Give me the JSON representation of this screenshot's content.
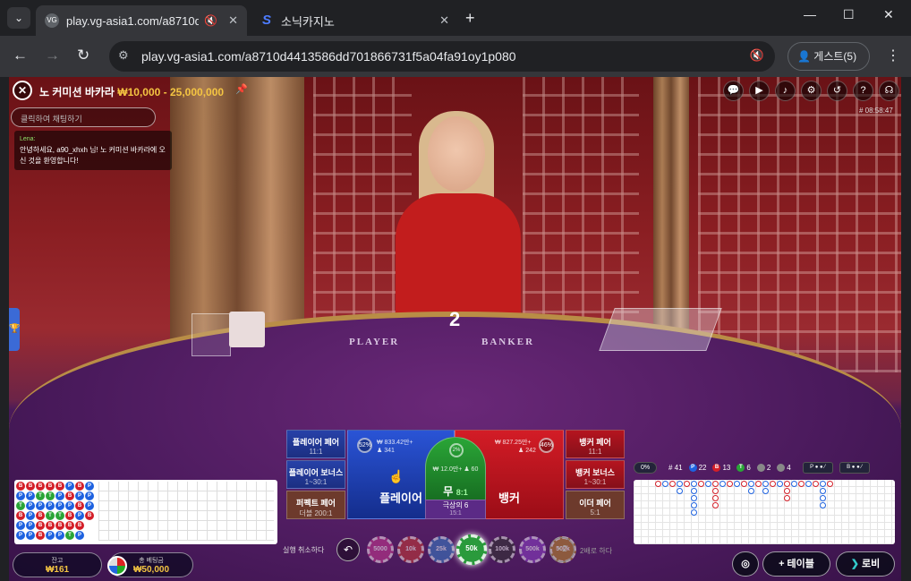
{
  "browser": {
    "tabs": [
      {
        "favicon": "VG",
        "title": "play.vg-asia1.com/a8710d4",
        "active": true
      },
      {
        "favicon": "S",
        "title": "소닉카지노",
        "active": false
      }
    ],
    "url": "play.vg-asia1.com/a8710d4413586dd701866731f5a04fa91oy1p080",
    "profile_label": "게스트(5)"
  },
  "game": {
    "table_name": "노 커미션 바카라",
    "limits": "₩10,000 - 25,000,000",
    "chat_placeholder": "클릭하여 채팅하기",
    "chat": {
      "user": "Lena:",
      "message": "안녕하세요, a90_xhxh 님! 노 커미션 바카라에 오신 것을 환영합니다!"
    },
    "game_id": "# 08:58:47",
    "round_number": "2",
    "felt_player": "PLAYER",
    "felt_banker": "BANKER",
    "hud_icons": [
      "chat-icon",
      "video-icon",
      "volume-icon",
      "settings-icon",
      "history-icon",
      "help-icon",
      "headset-icon"
    ]
  },
  "bets": {
    "player_pair": {
      "name": "플레이어 페어",
      "odds": "11:1"
    },
    "player_bonus": {
      "name": "플레이어 보너스",
      "odds": "1~30:1"
    },
    "perfect_pair": {
      "name": "퍼펙트 페어",
      "odds": "더블 200:1"
    },
    "player": {
      "name": "플레이어",
      "pct": "52%",
      "amount": "₩ 833.42만+",
      "players": "341",
      "pct_value": 52
    },
    "tie": {
      "name": "무",
      "odds": "8:1",
      "pct": "2%",
      "amount": "₩ 12.0만+",
      "players": "60"
    },
    "super6": {
      "name": "극상의 6",
      "odds": "15:1"
    },
    "banker": {
      "name": "뱅커",
      "pct": "46%",
      "amount": "₩ 827.25만+",
      "players": "242",
      "pct_value": 46
    },
    "banker_pair": {
      "name": "뱅커 페어",
      "odds": "11:1"
    },
    "banker_bonus": {
      "name": "뱅커 보너스",
      "odds": "1~30:1"
    },
    "either_pair": {
      "name": "이더 페어",
      "odds": "5:1"
    }
  },
  "road": {
    "bead": [
      "B",
      "P",
      "T",
      "B",
      "P",
      "P",
      "B",
      "P",
      "P",
      "P",
      "P",
      "P",
      "B",
      "T",
      "P",
      "B",
      "B",
      "B",
      "B",
      "T",
      "P",
      "T",
      "B",
      "P",
      "B",
      "P",
      "P",
      "T",
      "B",
      "P",
      "P",
      "B",
      "P",
      "B",
      "B",
      "T",
      "B",
      "P",
      "B",
      "P",
      "B",
      "P",
      "P",
      "P",
      "P",
      "B"
    ],
    "stats": {
      "pill": "0%",
      "total": "# 41",
      "player": "22",
      "banker": "13",
      "tie": "6",
      "player_pair": "2",
      "banker_pair": "4"
    },
    "predict_p": "P",
    "predict_b": "B"
  },
  "controls": {
    "undo_label": "실행 취소하다",
    "chips": [
      {
        "label": "5000",
        "color": "#c2388f",
        "selected": false
      },
      {
        "label": "10k",
        "color": "#c23838",
        "selected": false
      },
      {
        "label": "25k",
        "color": "#3878c2",
        "selected": false
      },
      {
        "label": "50k",
        "color": "#2a9a3c",
        "selected": true
      },
      {
        "label": "100k",
        "color": "#333333",
        "selected": false
      },
      {
        "label": "500k",
        "color": "#8a3fc2",
        "selected": false
      },
      {
        "label": "500k",
        "color": "#b8842a",
        "selected": false
      }
    ],
    "double_label": "×2",
    "repeat_label": "2배로 하다",
    "balance_label": "잔고",
    "balance": "₩161",
    "total_bet_label": "총 베팅금",
    "total_bet": "₩50,000",
    "table_btn": "+ 테이블",
    "lobby_btn": "로비"
  },
  "colors": {
    "player": "#1e62e0",
    "banker": "#d41f28",
    "tie": "#2aa537",
    "accent": "#f4c542"
  }
}
